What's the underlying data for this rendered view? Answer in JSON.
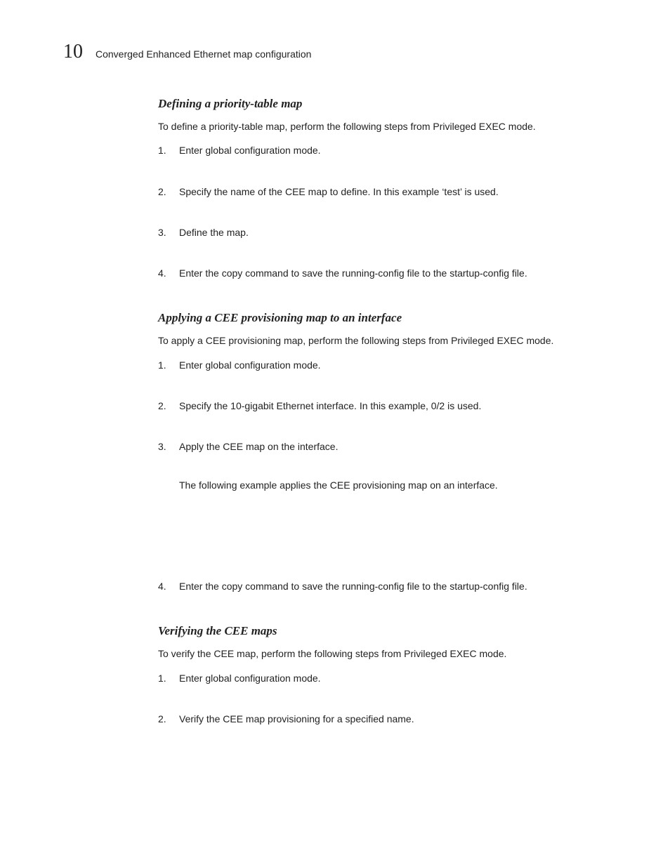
{
  "header": {
    "chapter_number": "10",
    "chapter_title": "Converged Enhanced Ethernet map configuration"
  },
  "sections": {
    "s1": {
      "title": "Defining a priority-table map",
      "intro": "To define a priority-table map, perform the following steps from Privileged EXEC mode.",
      "steps": {
        "i1": "Enter global configuration mode.",
        "i2": "Specify the name of the CEE map to define. In this example ‘test’ is used.",
        "i3": "Define the map.",
        "i4": "Enter the copy command to save the running-config file to the startup-config file."
      }
    },
    "s2": {
      "title": "Applying a CEE provisioning map to an interface",
      "intro": "To apply a CEE provisioning map, perform the following steps from Privileged EXEC mode.",
      "steps": {
        "i1": "Enter global configuration mode.",
        "i2": "Specify the 10-gigabit Ethernet interface. In this example, 0/2 is used.",
        "i3": "Apply the CEE map on the interface.",
        "i3_note": "The following example applies the CEE provisioning map on an interface.",
        "i4": "Enter the copy command to save the running-config file to the startup-config file."
      }
    },
    "s3": {
      "title": "Verifying the CEE maps",
      "intro": "To verify the CEE map, perform the following steps from Privileged EXEC mode.",
      "steps": {
        "i1": "Enter global configuration mode.",
        "i2": "Verify the CEE map provisioning for a specified name."
      }
    }
  }
}
